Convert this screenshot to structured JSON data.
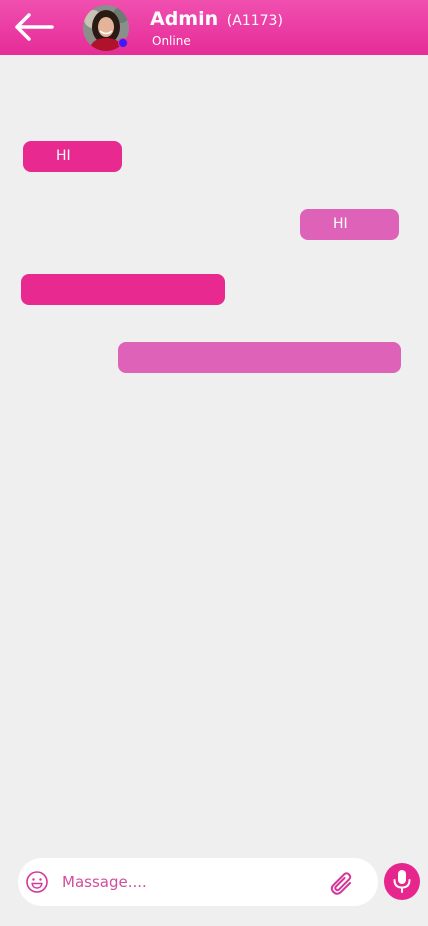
{
  "header": {
    "back_icon": "arrow-left-icon",
    "name": "Admin",
    "user_id": "(A1173)",
    "status": "Online",
    "presence_color": "#3a1bff",
    "bg_color": "#e62c97"
  },
  "messages": [
    {
      "direction": "received",
      "text": "HI",
      "color": "#e8298f"
    },
    {
      "direction": "sent",
      "text": "HI",
      "color": "#de62b8"
    },
    {
      "direction": "received",
      "text": "",
      "color": "#e8298f"
    },
    {
      "direction": "sent",
      "text": "",
      "color": "#de62b8"
    }
  ],
  "composer": {
    "emoji_icon": "smile-icon",
    "placeholder": "Massage....",
    "value": "",
    "attach_icon": "paperclip-icon",
    "mic_icon": "microphone-icon",
    "accent_color": "#e6268d"
  }
}
